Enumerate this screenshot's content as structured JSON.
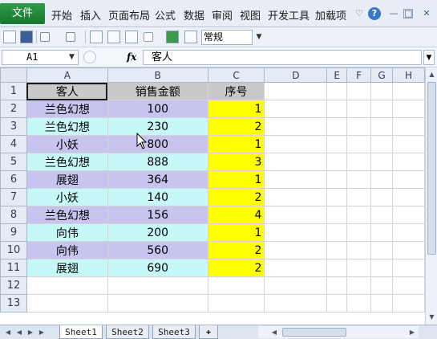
{
  "ribbon": {
    "file_tab": "文件",
    "tabs": [
      "开始",
      "插入",
      "页面布局",
      "公式",
      "数据",
      "审阅",
      "视图",
      "开发工具",
      "加载项"
    ],
    "help_icon": "?"
  },
  "toolbar": {
    "number_format": "常规"
  },
  "formula_bar": {
    "name_box": "A1",
    "fx_label": "fx",
    "formula_value": "客人"
  },
  "grid": {
    "columns": [
      "A",
      "B",
      "C",
      "D",
      "E",
      "F",
      "G",
      "H"
    ],
    "row_numbers": [
      "1",
      "2",
      "3",
      "4",
      "5",
      "6",
      "7",
      "8",
      "9",
      "10",
      "11",
      "12",
      "13"
    ],
    "header": [
      "客人",
      "销售金额",
      "序号"
    ],
    "rows": [
      {
        "guest": "兰色幻想",
        "amount": "100",
        "seq": "1"
      },
      {
        "guest": "兰色幻想",
        "amount": "230",
        "seq": "2"
      },
      {
        "guest": "小妖",
        "amount": "800",
        "seq": "1"
      },
      {
        "guest": "兰色幻想",
        "amount": "888",
        "seq": "3"
      },
      {
        "guest": "展翅",
        "amount": "364",
        "seq": "1"
      },
      {
        "guest": "小妖",
        "amount": "140",
        "seq": "2"
      },
      {
        "guest": "兰色幻想",
        "amount": "156",
        "seq": "4"
      },
      {
        "guest": "向伟",
        "amount": "200",
        "seq": "1"
      },
      {
        "guest": "向伟",
        "amount": "560",
        "seq": "2"
      },
      {
        "guest": "展翅",
        "amount": "690",
        "seq": "2"
      }
    ]
  },
  "sheets": [
    "Sheet1",
    "Sheet2",
    "Sheet3"
  ],
  "colors": {
    "lavender_row": "#c7c5ef",
    "cyan_row": "#c6f8f7",
    "seq_fill": "#ffff00",
    "header_fill": "#c9c9c9",
    "file_tab_green": "#1f8a3b"
  }
}
